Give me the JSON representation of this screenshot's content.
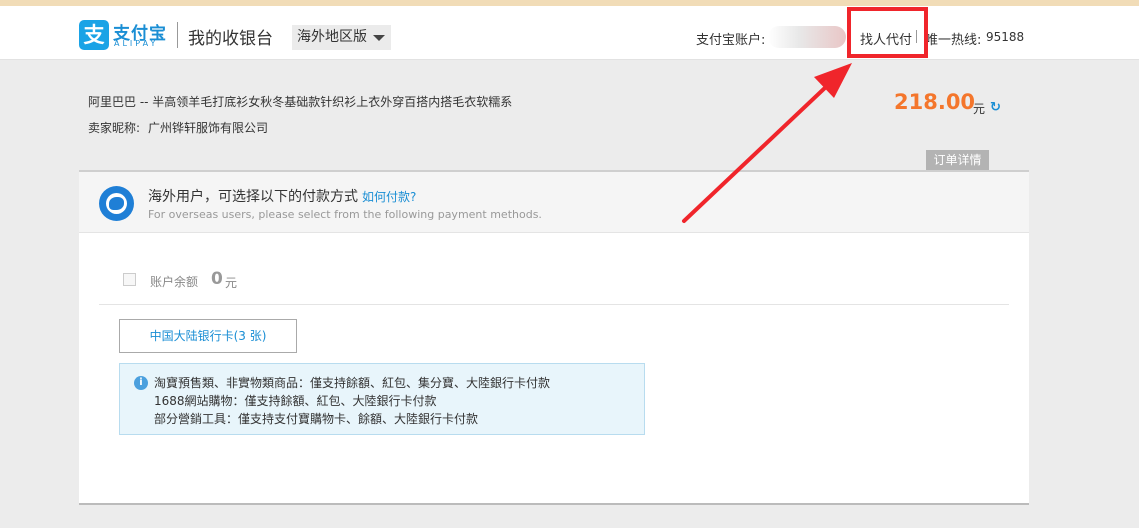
{
  "header": {
    "logo_glyph": "支",
    "logo_cn": "支付宝",
    "logo_en": "ALIPAY",
    "site_title": "我的收银台",
    "region_select": "海外地区版",
    "account_label": "支付宝账户:",
    "find_payer": "找人代付",
    "hotline_label": "唯一热线:",
    "hotline_number": "95188"
  },
  "order": {
    "title": "阿里巴巴 -- 半高领羊毛打底衫女秋冬基础款针织衫上衣外穿百搭内搭毛衣软糯系",
    "seller_label": "卖家昵称:",
    "seller_name": "广州铧轩服饰有限公司",
    "amount": "218.00",
    "amount_unit": "元",
    "detail_button": "订单详情"
  },
  "notice": {
    "cn": "海外用户，可选择以下的付款方式",
    "link": "如何付款?",
    "en": "For overseas users, please select from the following payment methods."
  },
  "balance": {
    "label": "账户余额",
    "value": "0",
    "unit": "元"
  },
  "bank_tab": "中国大陆银行卡(3 张)",
  "info": {
    "lines": [
      "淘寶預售類、非實物類商品：僅支持餘額、紅包、集分寶、大陸銀行卡付款",
      "1688網站購物：僅支持餘額、紅包、大陸銀行卡付款",
      "部分營銷工具：僅支持支付寶購物卡、餘額、大陸銀行卡付款"
    ]
  },
  "colors": {
    "brand_blue": "#1a8ed4",
    "amount_orange": "#f4762c",
    "annotation_red": "#f0252b"
  },
  "icons": {
    "refresh": "refresh-icon",
    "globe": "globe-icon",
    "info": "info-icon",
    "caret": "chevron-down-icon"
  }
}
